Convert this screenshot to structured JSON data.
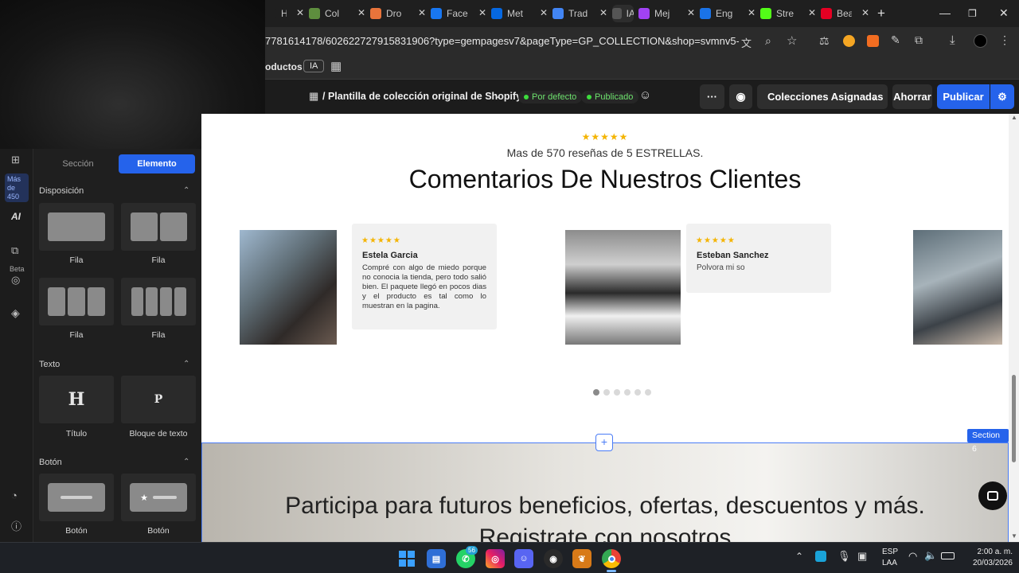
{
  "browser": {
    "tabs": [
      {
        "label": "Hor",
        "icon": "tab-icon",
        "color": "#1f1f1f"
      },
      {
        "label": "Col",
        "icon": "shopify-icon",
        "color": "#5e8e3e"
      },
      {
        "label": "Dro",
        "icon": "dropi-icon",
        "color": "#e8743b"
      },
      {
        "label": "Face",
        "icon": "facebook-icon",
        "color": "#1877f2"
      },
      {
        "label": "Met",
        "icon": "meta-icon",
        "color": "#0668e1"
      },
      {
        "label": "Trad",
        "icon": "translate-icon",
        "color": "#4285f4"
      },
      {
        "label": "IA",
        "icon": "ia-icon",
        "color": "#555555"
      },
      {
        "label": "Mej",
        "icon": "mej-icon",
        "color": "#a142f4"
      },
      {
        "label": "Eng",
        "icon": "dict-icon",
        "color": "#1a73e8"
      },
      {
        "label": "Stre",
        "icon": "kick-icon",
        "color": "#53fc18"
      },
      {
        "label": "Bea",
        "icon": "pinterest-icon",
        "color": "#e60023"
      }
    ],
    "url": "7781614178/602622727915831906?type=gempagesv7&pageType=GP_COLLECTION&shop=svmnv5-0w.myshopi...",
    "bookmark_items": [
      "oductos",
      "IA"
    ]
  },
  "app_header": {
    "breadcrumb": "/ Plantilla de colección original de Shopify",
    "status_default": "Por defecto",
    "status_published": "Publicado",
    "assigned_collections": "Colecciones Asignadas",
    "save_label": "Ahorrar",
    "publish_label": "Publicar",
    "more_label": "···"
  },
  "rail": {
    "badge": "Más de 450",
    "ai_label": "AI",
    "beta_label": "Beta"
  },
  "panel": {
    "tab_section": "Sección",
    "tab_element": "Elemento",
    "layout_header": "Disposición",
    "layout_items": [
      "Fila",
      "Fila",
      "Fila",
      "Fila"
    ],
    "text_header": "Texto",
    "text_items": [
      {
        "glyph": "H",
        "label": "Título"
      },
      {
        "glyph": "P",
        "label": "Bloque de texto"
      }
    ],
    "button_header": "Botón",
    "button_items": [
      "Botón",
      "Botón"
    ]
  },
  "canvas": {
    "stars": "★★★★★",
    "review_count": "Mas de 570 reseñas de 5 ESTRELLAS.",
    "title": "Comentarios De Nuestros Clientes",
    "reviews": [
      {
        "stars": "★★★★★",
        "name": "Estela Garcia",
        "text": "Compré con algo de miedo porque no conocia la tienda, pero todo salió bien. El paquete llegó en pocos dias y el producto es tal como lo muestran en la pagina."
      },
      {
        "stars": "★★★★★",
        "name": "Esteban Sanchez",
        "text": "Polvora mi so"
      }
    ],
    "pagination_total": 6,
    "pagination_active": 0,
    "add_symbol": "+",
    "section_badge": "Section 6",
    "promo_title": "Participa para futuros beneficios, ofertas, descuentos y más.",
    "promo_subtitle": "Registrate con nosotros"
  },
  "taskbar": {
    "whatsapp_badge": "56",
    "lang": "ESP",
    "lang2": "LAA",
    "time": "2:00 a. m.",
    "date": "20/03/2026"
  }
}
